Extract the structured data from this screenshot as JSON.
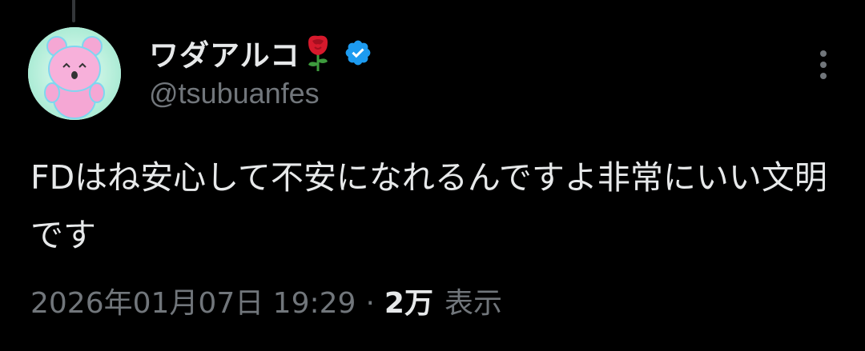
{
  "tweet": {
    "author": {
      "display_name": "ワダアルコ",
      "name_emoji": "rose-icon",
      "verified": true,
      "handle": "@tsubuanfes"
    },
    "text": "FDはね安心して不安になれるんですよ非常にいい文明です",
    "meta": {
      "timestamp": "2026年01月07日 19:29",
      "separator": "·",
      "views_count": "2万",
      "views_label": "表示"
    }
  },
  "colors": {
    "background": "#000000",
    "primary_text": "#e7e9ea",
    "secondary_text": "#71767b",
    "verified_badge": "#1d9bf0",
    "thread_line": "#333639"
  },
  "icons": {
    "more": "more-vertical-icon",
    "verified": "verified-badge-icon",
    "rose": "rose-icon"
  }
}
